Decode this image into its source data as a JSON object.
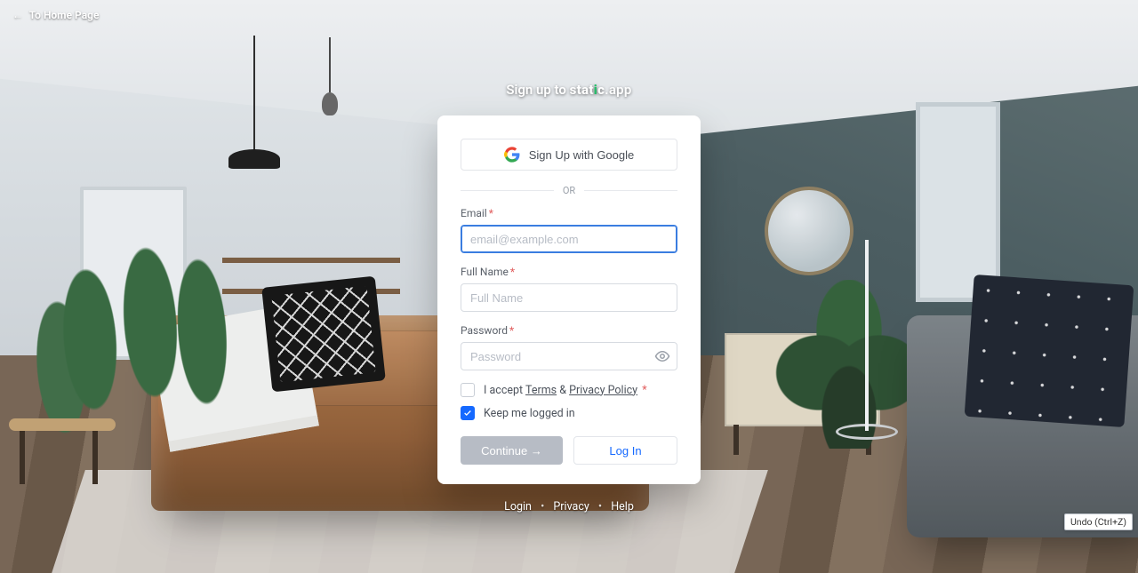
{
  "back_link": {
    "arrow": "←",
    "prefix": "To",
    "target": "Home Page"
  },
  "heading": {
    "prefix": "Sign up to",
    "brand_bold": "stat",
    "brand_dot": "i",
    "brand_tail": "c",
    "brand_suffix": ".app"
  },
  "google_btn": {
    "label": "Sign Up with Google"
  },
  "divider": {
    "text": "OR"
  },
  "fields": {
    "email": {
      "label": "Email",
      "required": "*",
      "placeholder": "email@example.com",
      "value": ""
    },
    "fullname": {
      "label": "Full Name",
      "required": "*",
      "placeholder": "Full Name",
      "value": ""
    },
    "password": {
      "label": "Password",
      "required": "*",
      "placeholder": "Password",
      "value": ""
    }
  },
  "terms": {
    "checked": false,
    "prefix": "I accept",
    "terms_link": "Terms",
    "amp": "&",
    "privacy_link": "Privacy Policy",
    "required": "*"
  },
  "keep_logged": {
    "checked": true,
    "label": "Keep me logged in"
  },
  "buttons": {
    "continue": "Continue →",
    "login": "Log In"
  },
  "footer": {
    "login": "Login",
    "privacy": "Privacy",
    "help": "Help",
    "sep": "•"
  },
  "undo_hint": "Undo (Ctrl+Z)"
}
